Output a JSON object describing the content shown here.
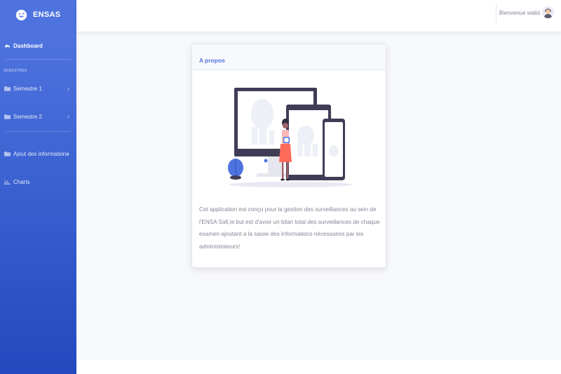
{
  "app": {
    "brand": "ENSAS"
  },
  "sidebar": {
    "dashboard_label": "Dashboard",
    "section_heading": "SEMESTRES",
    "items": [
      {
        "label": "Semestre 1",
        "icon": "folder-icon"
      },
      {
        "label": "Semestre 2",
        "icon": "folder-icon"
      },
      {
        "label": "Ajout des informations",
        "icon": "folder-icon"
      },
      {
        "label": "Charts",
        "icon": "chart-icon"
      }
    ]
  },
  "topbar": {
    "user_greeting": "Bienvenue walid"
  },
  "card": {
    "title": "A propos",
    "text": "Cet application est conçu pour la gestion des surveillances au sein de l'ENSA Safi,le but est d'avoir un bilan total des surveillances de chaque examen ajoutant a la saisie des informations nécessaires par les administrateurs!"
  },
  "colors": {
    "primary": "#4e73df",
    "primary_dark": "#224abe",
    "text_muted": "#858796"
  }
}
